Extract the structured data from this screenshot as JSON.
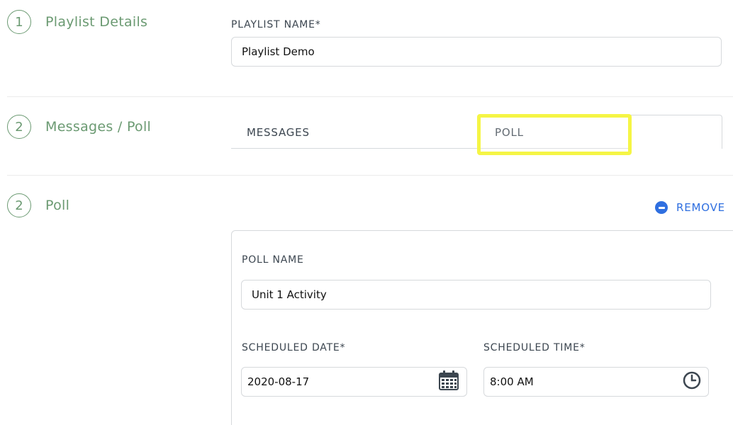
{
  "steps": [
    {
      "number": "1",
      "title": "Playlist Details"
    },
    {
      "number": "2",
      "title": "Messages / Poll"
    },
    {
      "number": "2",
      "title": "Poll"
    }
  ],
  "playlist": {
    "label": "PLAYLIST NAME*",
    "value": "Playlist Demo"
  },
  "tabs": [
    {
      "label": "MESSAGES",
      "active": false
    },
    {
      "label": "POLL",
      "active": true
    }
  ],
  "highlight_color": "#f5f545",
  "poll": {
    "remove_label": "REMOVE",
    "name_label": "POLL NAME",
    "name_value": "Unit 1 Activity",
    "date_label": "SCHEDULED DATE*",
    "date_value": "2020-08-17",
    "date_icon": "calendar-icon",
    "time_label": "SCHEDULED TIME*",
    "time_value": "8:00 AM",
    "time_icon": "clock-icon"
  },
  "colors": {
    "step_green": "#6b9a72",
    "link_blue": "#2f6fe0",
    "border": "#d6d9dc"
  }
}
